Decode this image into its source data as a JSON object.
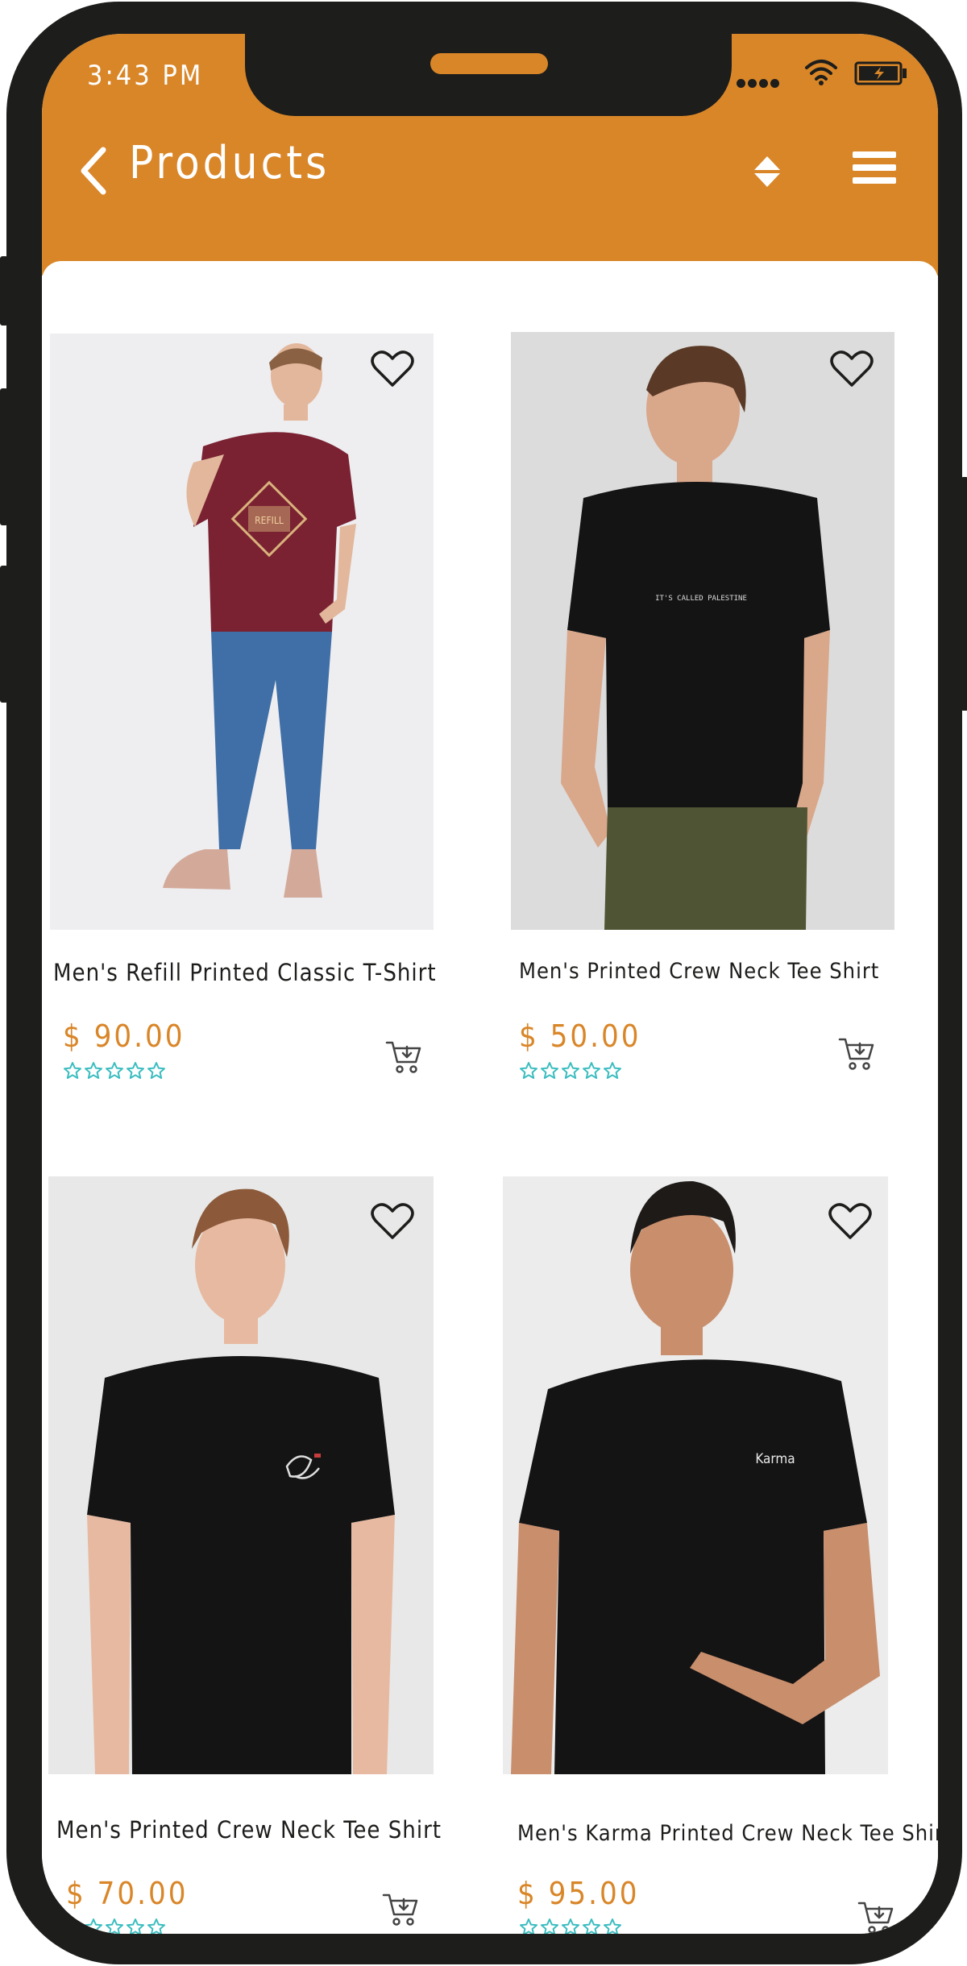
{
  "status_bar": {
    "time": "3:43 PM",
    "signal_icon": "signal-dots-icon",
    "wifi_icon": "wifi-icon",
    "battery_icon": "battery-charging-icon"
  },
  "header": {
    "back_icon": "chevron-left-icon",
    "title": "Products",
    "sort_icon": "sort-icon",
    "menu_icon": "hamburger-menu-icon"
  },
  "products": [
    {
      "name": "Men's Refill Printed Classic T-Shirt",
      "price": "$ 90.00",
      "rating": 0,
      "shirt_color": "#7a2232",
      "print_text": "REFILL",
      "favorite_icon": "heart-outline-icon",
      "cart_icon": "add-to-cart-icon"
    },
    {
      "name": "Men's  Printed Crew Neck Tee Shirt",
      "price": "$ 50.00",
      "rating": 0,
      "shirt_color": "#141414",
      "print_text": "IT'S CALLED PALESTINE",
      "favorite_icon": "heart-outline-icon",
      "cart_icon": "add-to-cart-icon"
    },
    {
      "name": "Men's Printed Crew Neck Tee Shirt",
      "price": "$ 70.00",
      "rating": 0,
      "shirt_color": "#141414",
      "print_text": "",
      "favorite_icon": "heart-outline-icon",
      "cart_icon": "add-to-cart-icon"
    },
    {
      "name": "Men's Karma Printed Crew Neck Tee Shirt",
      "price": "$ 95.00",
      "rating": 0,
      "shirt_color": "#141414",
      "print_text": "Karma",
      "favorite_icon": "heart-outline-icon",
      "cart_icon": "add-to-cart-icon"
    }
  ],
  "colors": {
    "accent": "#d98628",
    "frame": "#1d1d1b",
    "star": "#3bbdc0"
  }
}
